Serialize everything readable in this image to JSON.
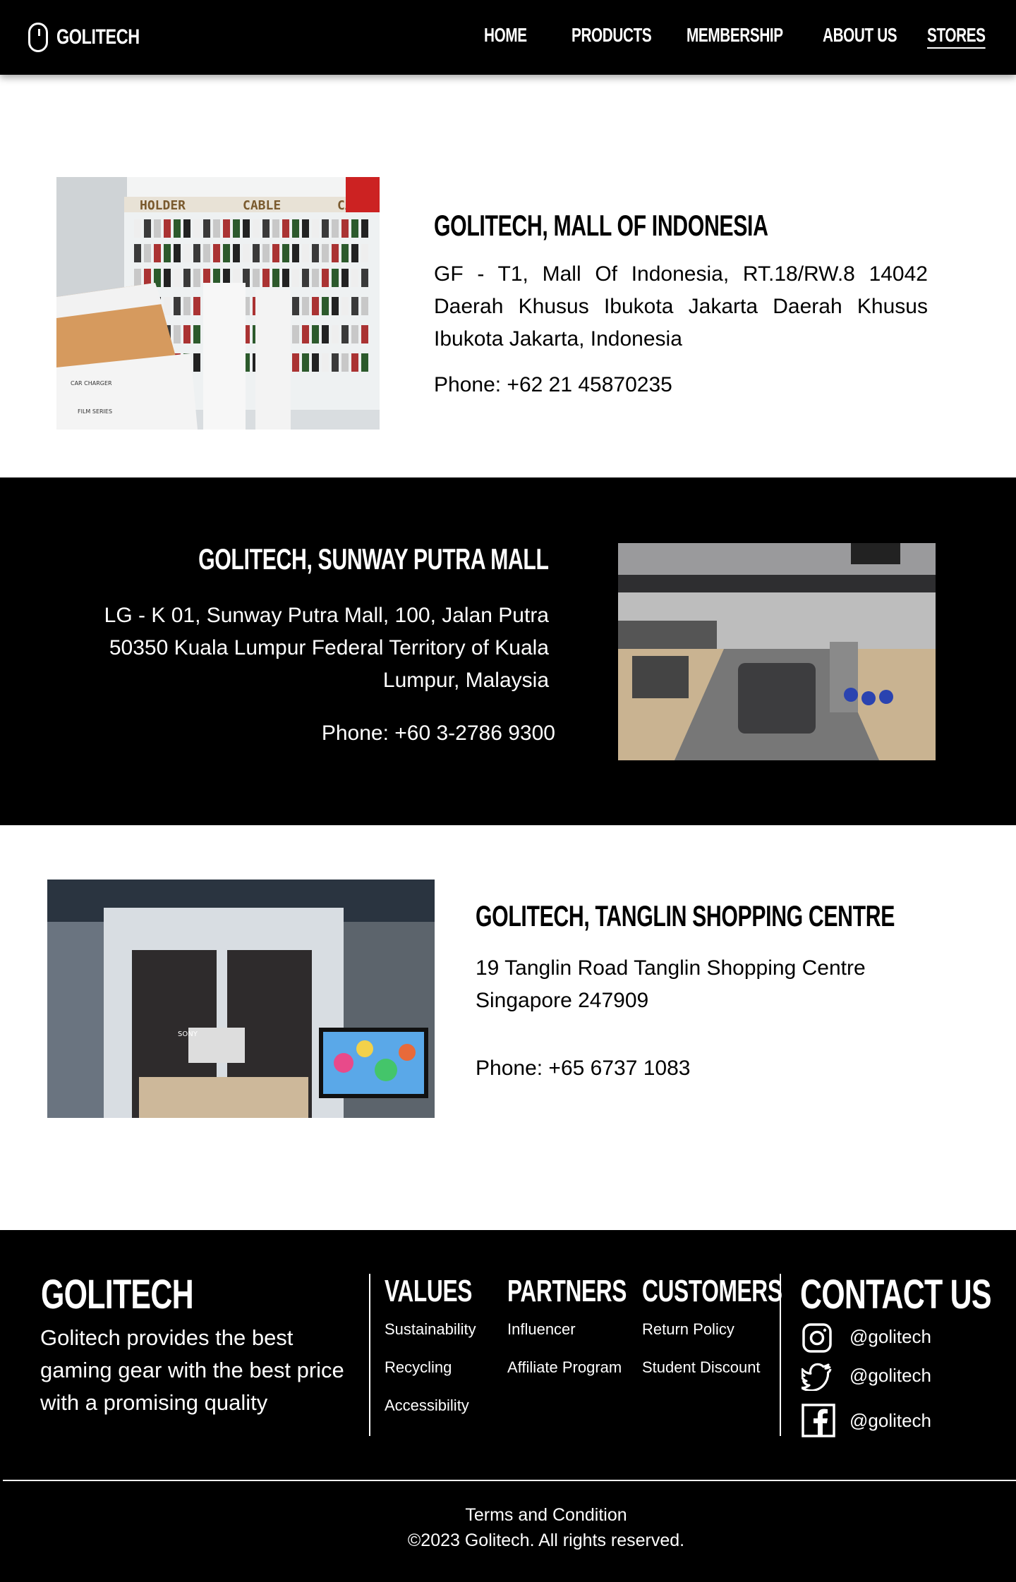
{
  "nav": {
    "brand": "GOLITECH",
    "items": [
      {
        "label": "HOME"
      },
      {
        "label": "PRODUCTS"
      },
      {
        "label": "MEMBERSHIP"
      },
      {
        "label": "ABOUT US"
      },
      {
        "label": "STORES"
      }
    ],
    "active": "STORES"
  },
  "stores": [
    {
      "title": "GOLITECH, MALL OF INDONESIA",
      "address": "GF - T1, Mall Of Indonesia, RT.18/RW.8 14042 Daerah Khusus Ibukota Jakarta Daerah Khusus Ibukota Jakarta, Indonesia",
      "phone": "Phone: +62 21 45870235",
      "photo_signs": [
        "HOLDER",
        "CABLE",
        "CAB"
      ],
      "photo_labels": [
        "CAR CHARGER",
        "FILM SERIES"
      ]
    },
    {
      "title": "GOLITECH, SUNWAY PUTRA MALL",
      "address": "LG - K 01, Sunway Putra Mall, 100, Jalan Putra 50350 Kuala Lumpur Federal Territory of Kuala Lumpur, Malaysia",
      "phone": "Phone: +60 3-2786 9300"
    },
    {
      "title": "GOLITECH, TANGLIN SHOPPING CENTRE",
      "address": "19 Tanglin Road Tanglin Shopping Centre Singapore 247909",
      "phone": "Phone: +65 6737 1083",
      "photo_labels": [
        "SONY"
      ]
    }
  ],
  "footer": {
    "brand": "GOLITECH",
    "description": "Golitech provides the best gaming gear with the best price with a promising quality",
    "columns": [
      {
        "heading": "VALUES",
        "links": [
          "Sustainability",
          "Recycling",
          "Accessibility"
        ]
      },
      {
        "heading": "PARTNERS",
        "links": [
          "Influencer",
          "Affiliate Program"
        ]
      },
      {
        "heading": "CUSTOMERS",
        "links": [
          "Return Policy",
          "Student Discount"
        ]
      }
    ],
    "contact": {
      "heading": "CONTACT US",
      "socials": [
        {
          "icon": "instagram-icon",
          "handle": "@golitech"
        },
        {
          "icon": "twitter-icon",
          "handle": "@golitech"
        },
        {
          "icon": "facebook-icon",
          "handle": "@golitech"
        }
      ]
    },
    "terms": "Terms and Condition",
    "copyright": "©2023 Golitech. All rights reserved."
  },
  "colors": {
    "primary": "#000000",
    "background": "#ffffff",
    "text_on_dark": "#ffffff"
  }
}
